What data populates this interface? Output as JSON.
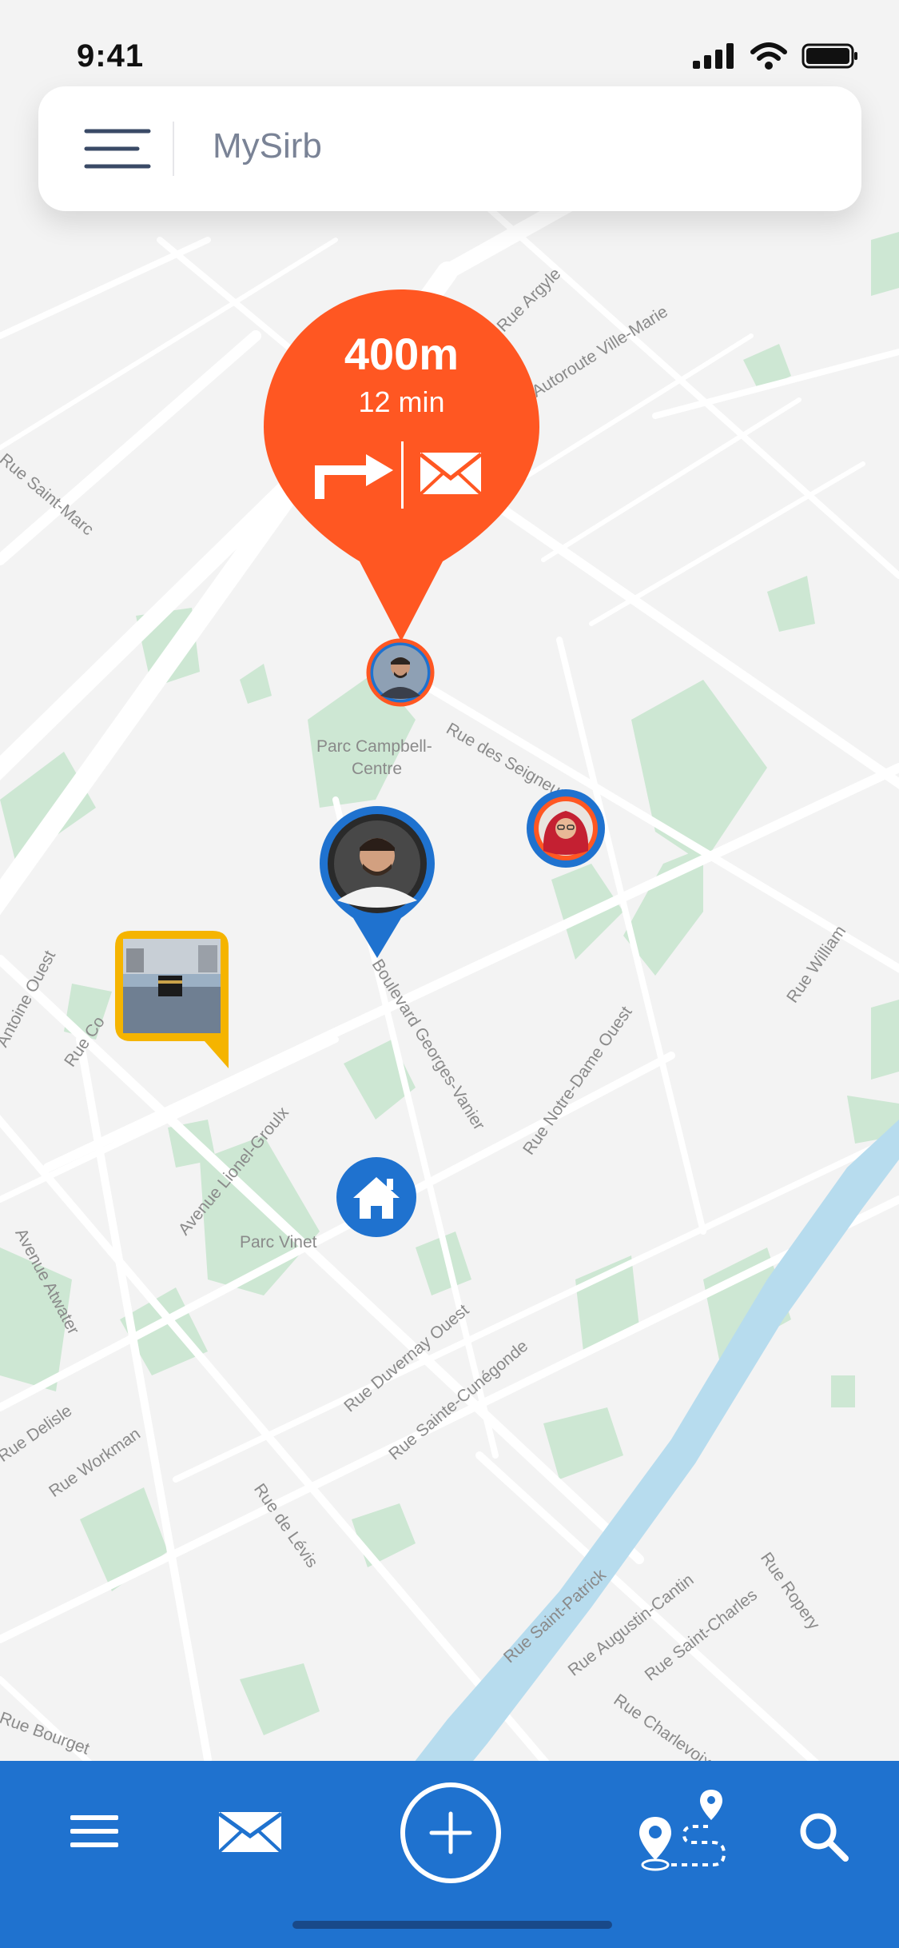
{
  "status_bar": {
    "time": "9:41"
  },
  "header": {
    "title": "MySirb"
  },
  "destination": {
    "distance": "400m",
    "eta": "12 min"
  },
  "map": {
    "labels": [
      "Parc Campbell-",
      "Centre",
      "Rue des Seigneurs",
      "Boulevard Georges-Vanier",
      "Rue Notre-Dame Ouest",
      "Avenue Lionel-Groulx",
      "Parc Vinet",
      "Rue Duvernay Ouest",
      "Rue Sainte-Cunégonde",
      "Avenue Atwater",
      "Rue Workman",
      "Rue Delisle",
      "Rue de Lévis",
      "Rue Saint-Patrick",
      "Rue Augustin-Cantin",
      "Rue Saint-Charles",
      "Rue Ropery",
      "Rue Charlevoix",
      "Rue William",
      "Antoine Ouest",
      "Rue Saint-Marc",
      "Autoroute Ville-Marie",
      "Rue Argyle",
      "Rue Bourget",
      "Rue Co"
    ]
  },
  "icons": {
    "menu": "menu-lines-icon",
    "turn": "turn-right-arrow-icon",
    "mail": "envelope-icon",
    "home": "home-icon",
    "add": "plus-circle-icon",
    "route": "route-pins-icon",
    "search": "magnifier-icon"
  },
  "colors": {
    "accent_orange": "#ff5722",
    "accent_blue": "#1f72cf",
    "marker_yellow": "#f5b400",
    "park_green": "#cde7d3",
    "river_blue": "#b7dcee"
  }
}
